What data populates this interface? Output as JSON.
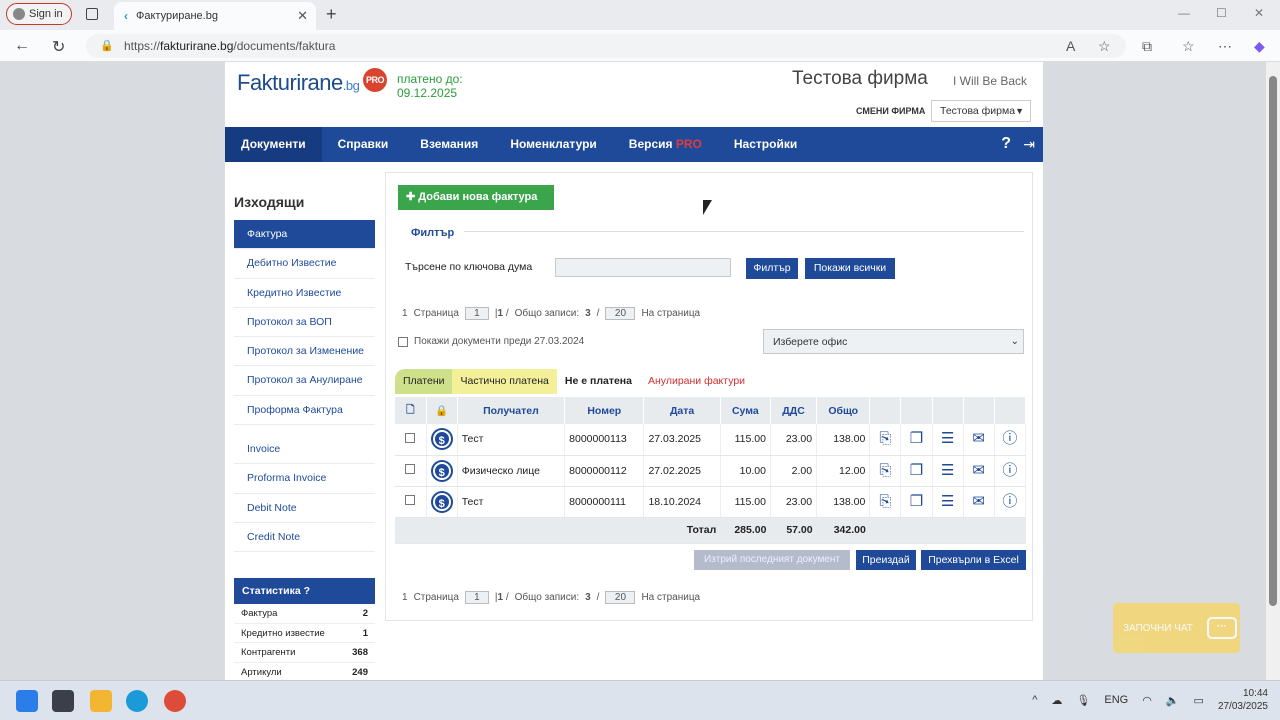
{
  "browser": {
    "signin_label": "Sign in",
    "tab_title": "Фактуриране.bg",
    "tab_favicon": "‹",
    "url_prefix": "https://",
    "url_main": "fakturirane.bg",
    "url_path": "/documents/faktura"
  },
  "header": {
    "logo_main": "Fakturirane",
    "logo_tld": ".bg",
    "logo_badge": "PRO",
    "paid_line1": "платено до:",
    "paid_line2": "09.12.2025",
    "company_name": "Тестова фирма",
    "company_subtitle": "I Will Be Back",
    "change_company_label": "СМЕНИ ФИРМА",
    "company_select_value": "Тестова фирма"
  },
  "nav": {
    "items": [
      {
        "label": "Документи"
      },
      {
        "label": "Справки"
      },
      {
        "label": "Вземания"
      },
      {
        "label": "Номенклатури"
      },
      {
        "label": "Версия",
        "badge": "PRO"
      },
      {
        "label": "Настройки"
      }
    ],
    "help": "?",
    "exit": "⇥"
  },
  "sidebar": {
    "title": "Изходящи",
    "items_bg": [
      "Фактура",
      "Дебитно Известие",
      "Кредитно Известие",
      "Протокол за ВОП",
      "Протокол за Изменение",
      "Протокол за Анулиране",
      "Проформа Фактура"
    ],
    "items_en": [
      "Invoice",
      "Proforma Invoice",
      "Debit Note",
      "Credit Note"
    ],
    "stats_title": "Статистика",
    "stats": [
      {
        "label": "Фактура",
        "value": "2"
      },
      {
        "label": "Кредитно известие",
        "value": "1"
      },
      {
        "label": "Контрагенти",
        "value": "368"
      },
      {
        "label": "Артикули",
        "value": "249"
      }
    ]
  },
  "main": {
    "add_button": "Добави нова фактура",
    "filter_title": "Филтър",
    "search_label": "Търсене по ключова дума",
    "search_value": "",
    "filter_button": "Филтър",
    "show_all_button": "Покажи всички",
    "pager": {
      "page_word": "Страница",
      "page": "1",
      "total_pages": "1",
      "records_word": "Общо записи:",
      "records": "3",
      "per_page": "20",
      "per_page_word": "На страница",
      "lead": "1"
    },
    "old_docs_label": "Покажи документи преди 27.03.2024",
    "office_select": "Изберете офис",
    "status_tabs": [
      "Платени",
      "Частично платена",
      "Не е платена",
      "Анулирани фактури"
    ],
    "table": {
      "headers": [
        "Получател",
        "Номер",
        "Дата",
        "Сума",
        "ДДС",
        "Общо"
      ],
      "rows": [
        {
          "recipient": "Тест",
          "number": "8000000113",
          "date": "27.03.2025",
          "sum": "115.00",
          "vat": "23.00",
          "total": "138.00"
        },
        {
          "recipient": "Физическо лице",
          "number": "8000000112",
          "date": "27.02.2025",
          "sum": "10.00",
          "vat": "2.00",
          "total": "12.00"
        },
        {
          "recipient": "Тест",
          "number": "8000000111",
          "date": "18.10.2024",
          "sum": "115.00",
          "vat": "23.00",
          "total": "138.00"
        }
      ],
      "total_label": "Тотал",
      "total_sum": "285.00",
      "total_vat": "57.00",
      "total_total": "342.00"
    },
    "delete_last_button": "Изтрий последният документ",
    "issue_button": "Преиздай",
    "excel_button": "Прехвърли в Excel"
  },
  "chat": {
    "label": "ЗАПОЧНИ ЧАТ"
  },
  "taskbar": {
    "lang": "ENG",
    "time": "10:44",
    "date": "27/03/2025"
  },
  "colors": {
    "primary": "#1f4a9a",
    "add_green": "#3aa54b",
    "pro_red": "#d9442e",
    "paid_green": "#2a9d3a"
  }
}
